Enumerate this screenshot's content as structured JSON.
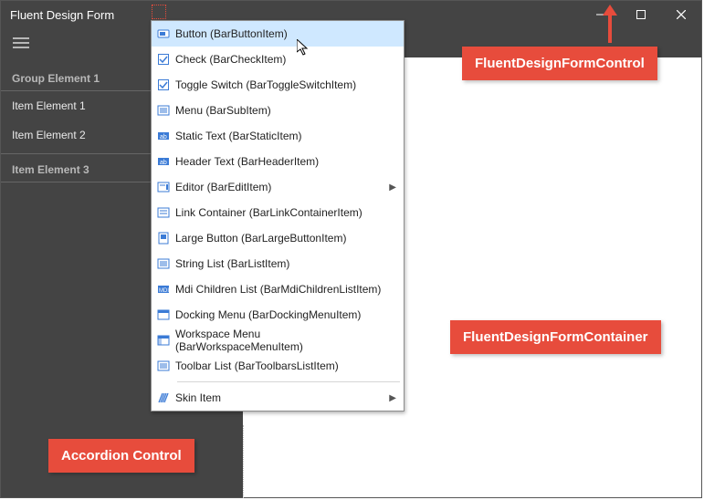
{
  "title": "Fluent Design Form",
  "sidebar": {
    "group1": "Group Element 1",
    "item1": "Item Element 1",
    "item2": "Item Element 2",
    "group2": "Item Element 3"
  },
  "menu": {
    "button": "Button (BarButtonItem)",
    "check": "Check (BarCheckItem)",
    "toggle": "Toggle Switch (BarToggleSwitchItem)",
    "menu": "Menu (BarSubItem)",
    "static": "Static Text (BarStaticItem)",
    "header": "Header Text (BarHeaderItem)",
    "editor": "Editor (BarEditItem)",
    "link": "Link Container (BarLinkContainerItem)",
    "large": "Large Button (BarLargeButtonItem)",
    "stringlist": "String List (BarListItem)",
    "mdi": "Mdi Children List (BarMdiChildrenListItem)",
    "docking": "Docking Menu (BarDockingMenuItem)",
    "workspace": "Workspace Menu (BarWorkspaceMenuItem)",
    "toolbar": "Toolbar List (BarToolbarsListItem)",
    "skin": "Skin Item"
  },
  "callouts": {
    "formcontrol": "FluentDesignFormControl",
    "formcontainer": "FluentDesignFormContainer",
    "accordion": "Accordion Control"
  }
}
